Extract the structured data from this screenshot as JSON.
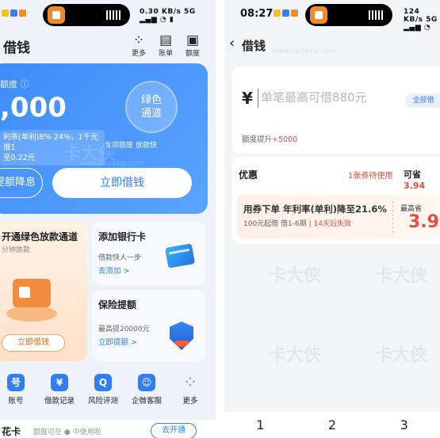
{
  "left": {
    "status": {
      "time_fragment": "0.30",
      "indicators": "KB/s 5G ▂▄▆ ◔ ▮"
    },
    "title": "借钱",
    "header_icons": [
      {
        "name": "more",
        "label": "更多",
        "icon": "grid-icon"
      },
      {
        "name": "bill",
        "label": "账单",
        "icon": "bill-icon"
      },
      {
        "name": "quota",
        "label": "额度",
        "icon": "wallet-icon"
      }
    ],
    "quota": {
      "label": "额度 ⓘ",
      "amount": ",000",
      "rate_line1": "利率(单利)8%-24%，1千元借1",
      "rate_line2": "至0.22元",
      "badge_line1": "绿色",
      "badge_line2": "通道",
      "tags": "专项额度  放款快",
      "boost_button": "提额降息",
      "borrow_button": "立即借钱"
    },
    "promo": {
      "title": "开通绿色放款通道",
      "subtitle": "分钟放款",
      "button": "立即借钱"
    },
    "bank_card": {
      "title": "添加银行卡",
      "desc": "借款快人一步",
      "link": "去添加 >"
    },
    "insurance": {
      "title": "保险提额",
      "desc": "最高提20000元",
      "link": "立即提额 >"
    },
    "quick_nav": [
      {
        "label": "账号",
        "glyph": "号"
      },
      {
        "label": "借款记录",
        "glyph": "¥"
      },
      {
        "label": "风险评测",
        "glyph": "Q"
      },
      {
        "label": "企微客服",
        "glyph": "☺"
      },
      {
        "label": "更多",
        "glyph": "⁘"
      }
    ],
    "huabei": {
      "name": "花卡",
      "desc": "额度可在 ● 中使用啦",
      "button": "去开通"
    }
  },
  "right": {
    "status": {
      "time": "08:27",
      "indicators": "124 KB/s 5G ▂▄▆ ◔"
    },
    "back": "‹",
    "title": "借钱",
    "amount": {
      "currency": "¥",
      "placeholder": "单笔最高可借880元",
      "all_button": "全部借",
      "increase_label": "额度提升",
      "increase_value": "+5000"
    },
    "coupon": {
      "label": "优惠",
      "count": "1张券待使用",
      "save_label": "可省",
      "save_value": "3.94",
      "box_title": "用券下单 年利率(单利)降至21.6%",
      "box_sub": "100元起借 借1-6期",
      "box_expire": "14天后失效",
      "max_label": "最高省",
      "max_value": "3.9"
    },
    "keypad": [
      "1",
      "2",
      "3"
    ]
  },
  "watermark": {
    "text": "卡大侠",
    "url": "www.kadaxia.com"
  }
}
